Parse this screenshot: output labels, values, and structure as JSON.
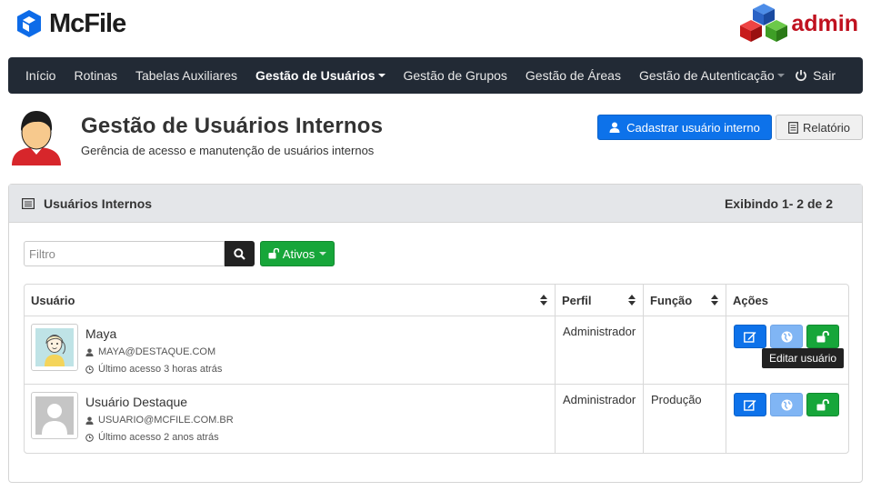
{
  "app": {
    "name": "McFile",
    "admin_label": "admin"
  },
  "nav": {
    "items": [
      {
        "label": "Início"
      },
      {
        "label": "Rotinas"
      },
      {
        "label": "Tabelas Auxiliares"
      },
      {
        "label": "Gestão de Usuários"
      },
      {
        "label": "Gestão de Grupos"
      },
      {
        "label": "Gestão de Áreas"
      },
      {
        "label": "Gestão de Autenticação"
      }
    ],
    "logout": "Sair"
  },
  "page": {
    "title": "Gestão de Usuários Internos",
    "subtitle": "Gerência de acesso e manutenção de usuários internos",
    "add_button": "Cadastrar usuário interno",
    "report_button": "Relatório"
  },
  "panel": {
    "title": "Usuários Internos",
    "count": "Exibindo 1- 2 de 2",
    "filter_placeholder": "Filtro",
    "filter_value": "",
    "status_button": "Ativos"
  },
  "table": {
    "headers": [
      "Usuário",
      "Perfil",
      "Função",
      "Ações"
    ],
    "rows": [
      {
        "name": "Maya",
        "email": "MAYA@DESTAQUE.COM",
        "last_access": "Último acesso 3 horas atrás",
        "profile": "Administrador",
        "function": ""
      },
      {
        "name": "Usuário Destaque",
        "email": "USUARIO@MCFILE.COM.BR",
        "last_access": "Último acesso 2 anos atrás",
        "profile": "Administrador",
        "function": "Produção"
      }
    ]
  },
  "tooltip": "Editar usuário",
  "colors": {
    "navbar": "#222a35",
    "primary": "#0d72ea",
    "success": "#17a63a",
    "brand_red": "#c0111f"
  }
}
